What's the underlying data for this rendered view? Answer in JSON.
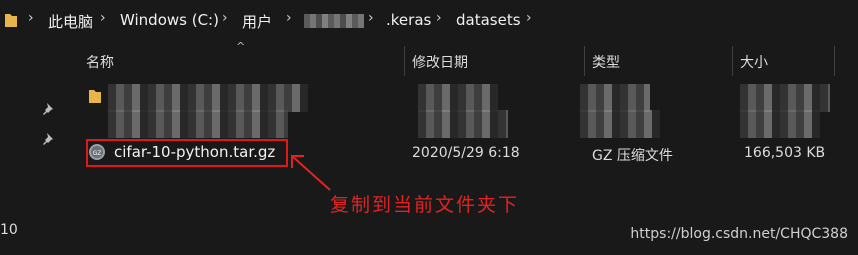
{
  "breadcrumb": {
    "items": [
      "此电脑",
      "Windows (C:)",
      "用户",
      ".keras",
      "datasets"
    ],
    "separator": "›"
  },
  "columns": {
    "name": "名称",
    "modified": "修改日期",
    "type": "类型",
    "size": "大小"
  },
  "file": {
    "name": "cifar-10-python.tar.gz",
    "modified": "2020/5/29 6:18",
    "type": "GZ 压缩文件",
    "size": "166,503 KB",
    "icon": "gz-archive-icon"
  },
  "annotation": {
    "text": "复制到当前文件夹下",
    "color": "#e02424"
  },
  "left_number": "10",
  "watermark": "https://blog.csdn.net/CHQC388"
}
